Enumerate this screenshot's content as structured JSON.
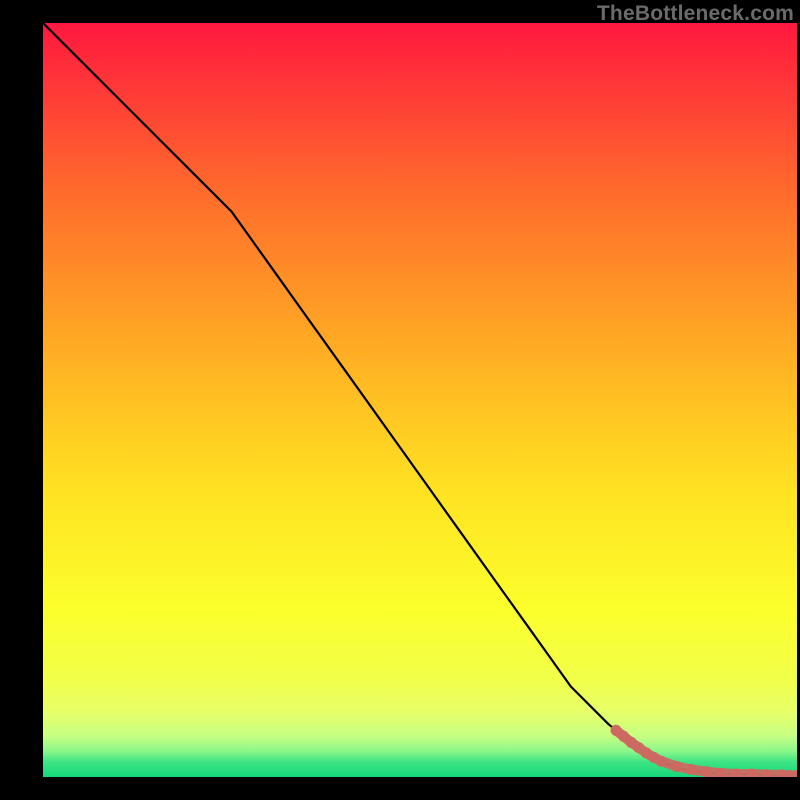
{
  "watermark": "TheBottleneck.com",
  "colors": {
    "gradient_top": "#ff183f",
    "gradient_q1": "#ff8f29",
    "gradient_mid": "#ffd524",
    "gradient_q3": "#f8ff34",
    "gradient_band": "#dfff6e",
    "gradient_bottom": "#18e07e",
    "line": "#000000",
    "marker": "#cc6a61"
  },
  "chart_data": {
    "type": "line",
    "title": "",
    "xlabel": "",
    "ylabel": "",
    "xlim": [
      0,
      100
    ],
    "ylim": [
      0,
      100
    ],
    "series": [
      {
        "name": "curve",
        "x": [
          0,
          5,
          10,
          15,
          20,
          25,
          30,
          35,
          40,
          45,
          50,
          55,
          60,
          65,
          70,
          75,
          80,
          82,
          85,
          88,
          90,
          92,
          95,
          98,
          100
        ],
        "y": [
          100,
          95,
          90,
          85,
          80,
          75,
          68,
          61,
          54,
          47,
          40,
          33,
          26,
          19,
          12,
          7,
          3,
          2,
          1,
          0.6,
          0.5,
          0.4,
          0.3,
          0.2,
          0.2
        ]
      },
      {
        "name": "markers",
        "x": [
          76,
          77,
          78,
          79,
          80,
          81,
          82,
          84,
          86,
          88,
          90,
          92,
          94,
          96,
          98,
          99,
          100
        ],
        "y": [
          6.2,
          5.4,
          4.6,
          3.9,
          3.2,
          2.6,
          2.1,
          1.4,
          1.0,
          0.7,
          0.5,
          0.4,
          0.4,
          0.3,
          0.3,
          0.2,
          0.2
        ]
      }
    ]
  }
}
